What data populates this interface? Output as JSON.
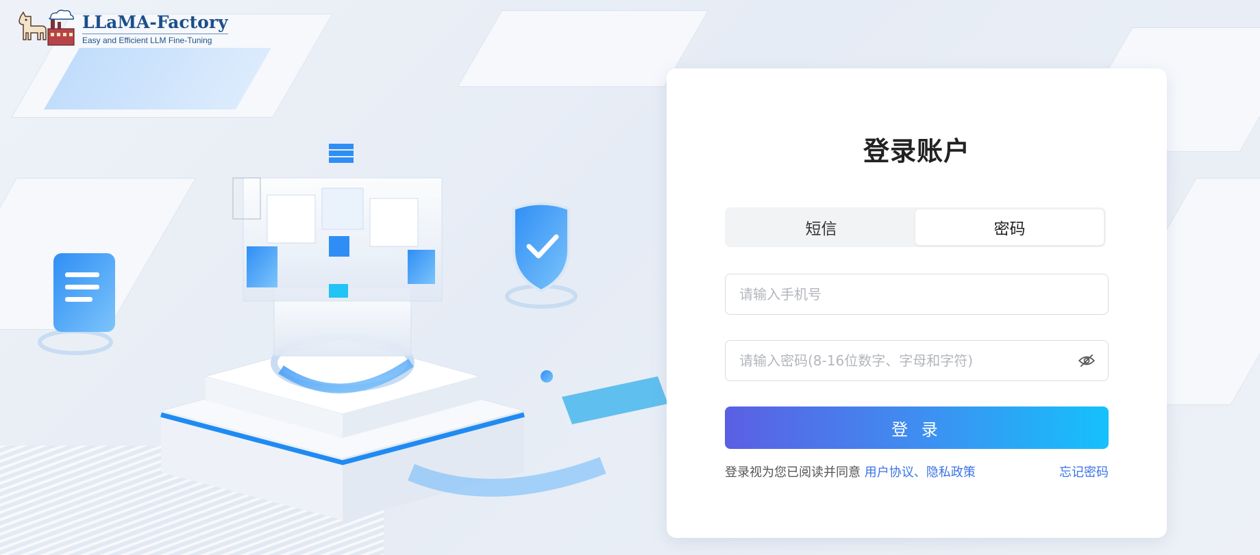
{
  "logo": {
    "title": "LLaMA-Factory",
    "subtitle": "Easy and Efficient LLM Fine-Tuning"
  },
  "login": {
    "title": "登录账户",
    "tabs": [
      {
        "label": "短信",
        "active": false
      },
      {
        "label": "密码",
        "active": true
      }
    ],
    "phone_placeholder": "请输入手机号",
    "password_placeholder": "请输入密码(8-16位数字、字母和字符)",
    "submit_label": "登 录",
    "agreement_prefix": "登录视为您已阅读并同意 ",
    "user_agreement": "用户协议",
    "separator": "、",
    "privacy_policy": "隐私政策",
    "forgot_password": "忘记密码"
  },
  "icons": {
    "password_toggle": "eye-off-icon"
  },
  "colors": {
    "accent": "#3a73e6",
    "button_gradient_start": "#5b5fe3",
    "button_gradient_end": "#15c1fb",
    "logo_text": "#1b4f8a"
  }
}
